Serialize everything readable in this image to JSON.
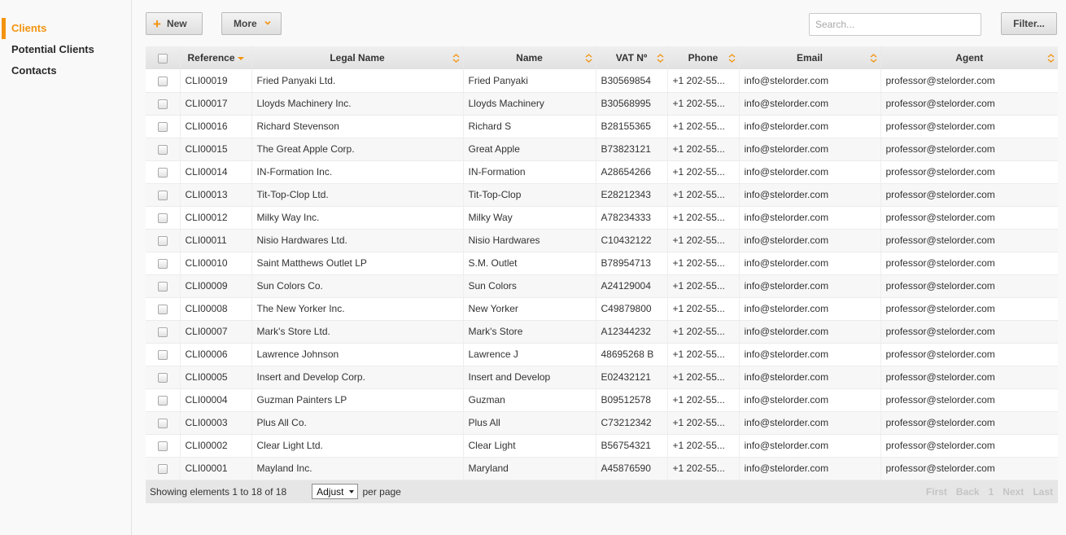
{
  "sidebar": {
    "items": [
      {
        "label": "Clients",
        "active": true
      },
      {
        "label": "Potential Clients",
        "active": false
      },
      {
        "label": "Contacts",
        "active": false
      }
    ]
  },
  "toolbar": {
    "new_label": "New",
    "more_label": "More",
    "search_placeholder": "Search...",
    "filter_label": "Filter..."
  },
  "table": {
    "columns": [
      "Reference",
      "Legal Name",
      "Name",
      "VAT Nº",
      "Phone",
      "Email",
      "Agent"
    ],
    "rows": [
      [
        "CLI00019",
        "Fried Panyaki Ltd.",
        "Fried Panyaki",
        "B30569854",
        "+1 202-55...",
        "info@stelorder.com",
        "professor@stelorder.com"
      ],
      [
        "CLI00017",
        "Lloyds Machinery Inc.",
        "Lloyds Machinery",
        "B30568995",
        "+1 202-55...",
        "info@stelorder.com",
        "professor@stelorder.com"
      ],
      [
        "CLI00016",
        "Richard Stevenson",
        "Richard S",
        "B28155365",
        "+1 202-55...",
        "info@stelorder.com",
        "professor@stelorder.com"
      ],
      [
        "CLI00015",
        "The Great Apple Corp.",
        "Great Apple",
        "B73823121",
        "+1 202-55...",
        "info@stelorder.com",
        "professor@stelorder.com"
      ],
      [
        "CLI00014",
        "IN-Formation Inc.",
        "IN-Formation",
        "A28654266",
        "+1 202-55...",
        "info@stelorder.com",
        "professor@stelorder.com"
      ],
      [
        "CLI00013",
        "Tit-Top-Clop Ltd.",
        "Tit-Top-Clop",
        "E28212343",
        "+1 202-55...",
        "info@stelorder.com",
        "professor@stelorder.com"
      ],
      [
        "CLI00012",
        "Milky Way Inc.",
        "Milky Way",
        "A78234333",
        "+1 202-55...",
        "info@stelorder.com",
        "professor@stelorder.com"
      ],
      [
        "CLI00011",
        "Nisio Hardwares Ltd.",
        "Nisio Hardwares",
        "C10432122",
        "+1 202-55...",
        "info@stelorder.com",
        "professor@stelorder.com"
      ],
      [
        "CLI00010",
        "Saint Matthews Outlet LP",
        "S.M. Outlet",
        "B78954713",
        "+1 202-55...",
        "info@stelorder.com",
        "professor@stelorder.com"
      ],
      [
        "CLI00009",
        "Sun Colors Co.",
        "Sun Colors",
        "A24129004",
        "+1 202-55...",
        "info@stelorder.com",
        "professor@stelorder.com"
      ],
      [
        "CLI00008",
        "The New Yorker Inc.",
        "New Yorker",
        "C49879800",
        "+1 202-55...",
        "info@stelorder.com",
        "professor@stelorder.com"
      ],
      [
        "CLI00007",
        "Mark's Store Ltd.",
        "Mark's Store",
        "A12344232",
        "+1 202-55...",
        "info@stelorder.com",
        "professor@stelorder.com"
      ],
      [
        "CLI00006",
        "Lawrence Johnson",
        "Lawrence J",
        "48695268 B",
        "+1 202-55...",
        "info@stelorder.com",
        "professor@stelorder.com"
      ],
      [
        "CLI00005",
        "Insert and Develop Corp.",
        "Insert and Develop",
        "E02432121",
        "+1 202-55...",
        "info@stelorder.com",
        "professor@stelorder.com"
      ],
      [
        "CLI00004",
        "Guzman Painters LP",
        "Guzman",
        "B09512578",
        "+1 202-55...",
        "info@stelorder.com",
        "professor@stelorder.com"
      ],
      [
        "CLI00003",
        "Plus All Co.",
        "Plus All",
        "C73212342",
        "+1 202-55...",
        "info@stelorder.com",
        "professor@stelorder.com"
      ],
      [
        "CLI00002",
        "Clear Light Ltd.",
        "Clear Light",
        "B56754321",
        "+1 202-55...",
        "info@stelorder.com",
        "professor@stelorder.com"
      ],
      [
        "CLI00001",
        "Mayland Inc.",
        "Maryland",
        "A45876590",
        "+1 202-55...",
        "info@stelorder.com",
        "professor@stelorder.com"
      ]
    ]
  },
  "footer": {
    "showing": "Showing elements 1 to 18 of 18",
    "per_page_value": "Adjust",
    "per_page_label": "per page",
    "pager": {
      "first": "First",
      "back": "Back",
      "page": "1",
      "next": "Next",
      "last": "Last"
    }
  },
  "colors": {
    "accent": "#f39410"
  },
  "icons": {
    "new": "plus-icon",
    "more": "chevron-down-icon",
    "sort": "sort-icon",
    "sort_desc": "sort-desc-arrow-icon"
  }
}
